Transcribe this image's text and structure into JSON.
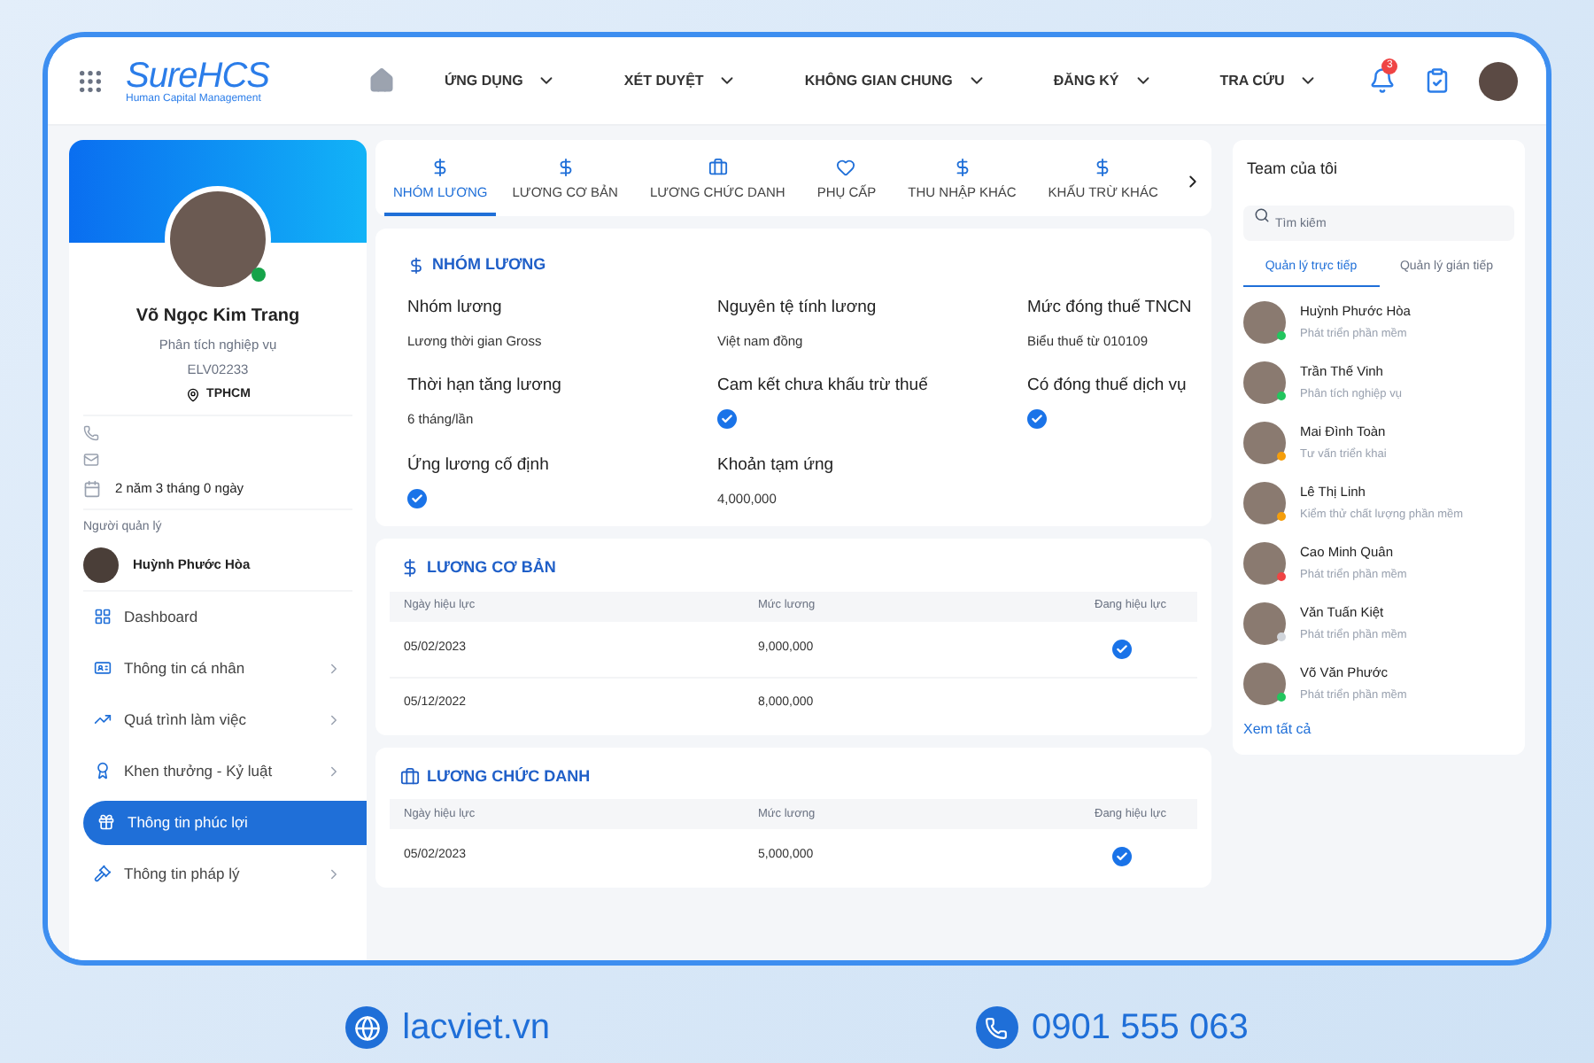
{
  "header": {
    "logo": {
      "brand": "SureHCS",
      "tagline": "Human Capital Management"
    },
    "nav": [
      {
        "label": "ỨNG DỤNG"
      },
      {
        "label": "XÉT DUYỆT"
      },
      {
        "label": "KHÔNG GIAN CHUNG"
      },
      {
        "label": "ĐĂNG KÝ"
      },
      {
        "label": "TRA CỨU"
      }
    ],
    "notification_count": "3"
  },
  "profile": {
    "name": "Võ Ngọc Kim Trang",
    "role": "Phân tích nghiệp vụ",
    "code": "ELV02233",
    "location": "TPHCM",
    "online": true,
    "tenure": "2 năm 3 tháng 0 ngày",
    "manager_label": "Người quản lý",
    "manager_name": "Huỳnh Phước Hòa"
  },
  "menu": [
    {
      "label": "Dashboard",
      "kind": "grid",
      "expandable": false,
      "selected": false
    },
    {
      "label": "Thông tin cá nhân",
      "kind": "id",
      "expandable": true,
      "selected": false
    },
    {
      "label": "Quá trình làm việc",
      "kind": "trend",
      "expandable": true,
      "selected": false
    },
    {
      "label": "Khen thưởng - Kỷ luật",
      "kind": "award",
      "expandable": true,
      "selected": false
    },
    {
      "label": "Thông tin phúc lợi",
      "kind": "gift",
      "expandable": false,
      "selected": true
    },
    {
      "label": "Thông tin pháp lý",
      "kind": "gavel",
      "expandable": true,
      "selected": false
    }
  ],
  "tabs": [
    {
      "label": "NHÓM LƯƠNG",
      "kind": "dollar",
      "selected": true
    },
    {
      "label": "LƯƠNG CƠ BẢN",
      "kind": "dollar",
      "selected": false
    },
    {
      "label": "LƯƠNG CHỨC DANH",
      "kind": "briefcase",
      "selected": false
    },
    {
      "label": "PHỤ CẤP",
      "kind": "heart",
      "selected": false
    },
    {
      "label": "THU NHẬP KHÁC",
      "kind": "dollar",
      "selected": false
    },
    {
      "label": "KHẤU TRỪ KHÁC",
      "kind": "dollar",
      "selected": false
    }
  ],
  "salary_group": {
    "title": "NHÓM LƯƠNG",
    "fields": [
      {
        "label": "Nhóm lương",
        "kind": "text",
        "value": "Lương thời gian Gross"
      },
      {
        "label": "Nguyên tệ tính lương",
        "kind": "text",
        "value": "Việt nam đồng"
      },
      {
        "label": "Mức đóng thuế TNCN",
        "kind": "text",
        "value": "Biểu thuế từ 010109"
      },
      {
        "label": "Thời hạn tăng lương",
        "kind": "text",
        "value": "6 tháng/lần"
      },
      {
        "label": "Cam kết chưa khấu trừ thuế",
        "kind": "check",
        "checked": true
      },
      {
        "label": "Có đóng thuế dịch vụ",
        "kind": "check",
        "checked": true
      },
      {
        "label": "Ứng lương cố định",
        "kind": "check",
        "checked": true
      },
      {
        "label": "Khoản tạm ứng",
        "kind": "text",
        "value": "4,000,000"
      }
    ]
  },
  "tables": [
    {
      "title": "LƯƠNG CƠ BẢN",
      "kind": "dollar",
      "columns": [
        "Ngày hiệu lực",
        "Mức lương",
        "Đang hiệu lực"
      ],
      "rows": [
        {
          "date": "05/02/2023",
          "amount": "9,000,000",
          "active": true
        },
        {
          "date": "05/12/2022",
          "amount": "8,000,000",
          "active": false
        }
      ]
    },
    {
      "title": "LƯƠNG CHỨC DANH",
      "kind": "briefcase",
      "columns": [
        "Ngày hiệu lực",
        "Mức lương",
        "Đang hiệu lực"
      ],
      "rows": [
        {
          "date": "05/02/2023",
          "amount": "5,000,000",
          "active": true
        }
      ]
    }
  ],
  "team": {
    "title": "Team của tôi",
    "search_placeholder": "Tìm kiếm",
    "tabs": [
      {
        "label": "Quản lý trực tiếp",
        "selected": true
      },
      {
        "label": "Quản lý gián tiếp",
        "selected": false
      }
    ],
    "members": [
      {
        "name": "Huỳnh Phước Hòa",
        "role": "Phát triển phần mềm",
        "color": "#22c55e"
      },
      {
        "name": "Trần Thế Vinh",
        "role": "Phân tích nghiệp vụ",
        "color": "#22c55e"
      },
      {
        "name": "Mai Đình Toàn",
        "role": "Tư vấn triển khai",
        "color": "#f59e0b"
      },
      {
        "name": "Lê Thị Linh",
        "role": "Kiểm thử chất lượng phần mềm",
        "color": "#f59e0b"
      },
      {
        "name": "Cao Minh Quân",
        "role": "Phát triển phần mềm",
        "color": "#ef4444"
      },
      {
        "name": "Văn Tuấn Kiệt",
        "role": "Phát triển phần mềm",
        "color": "#d1d5db"
      },
      {
        "name": "Võ Văn Phước",
        "role": "Phát triển phần mềm",
        "color": "#22c55e"
      }
    ],
    "see_all": "Xem tất cả"
  },
  "footer": {
    "website": "lacviet.vn",
    "phone": "0901 555 063"
  }
}
